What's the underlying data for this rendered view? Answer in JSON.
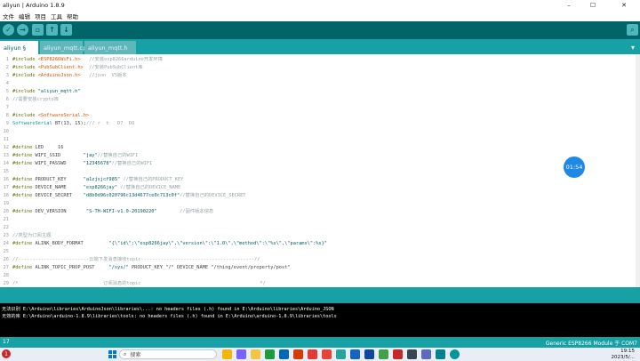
{
  "window": {
    "title": "aliyun | Arduino 1.8.9",
    "min": "–",
    "max": "☐",
    "close": "✕"
  },
  "menu": [
    "文件",
    "编辑",
    "项目",
    "工具",
    "帮助"
  ],
  "toolbar": {
    "verify": "✓",
    "upload": "→",
    "new": "▫",
    "open": "↑",
    "save": "↓",
    "serial_monitor": "⌕"
  },
  "tabs": [
    {
      "label": "aliyun §",
      "active": true
    },
    {
      "label": "aliyun_mqtt.cpp",
      "active": false
    },
    {
      "label": "aliyun_mqtt.h",
      "active": false
    }
  ],
  "tab_menu": "▾",
  "code": [
    {
      "n": "1",
      "segs": [
        [
          "kw",
          "#include "
        ],
        [
          "hl",
          "<ESP8266WiFi.h>"
        ],
        [
          "cm",
          "   //安装esp8266arduino开发环境"
        ]
      ]
    },
    {
      "n": "2",
      "segs": [
        [
          "kw",
          "#include "
        ],
        [
          "hl",
          "<PubSubClient.h>"
        ],
        [
          "cm",
          "  //安装PubSubClient库"
        ]
      ]
    },
    {
      "n": "3",
      "segs": [
        [
          "kw",
          "#include "
        ],
        [
          "hl",
          "<ArduinoJson.h>"
        ],
        [
          "cm",
          "   //json  V5版本"
        ]
      ]
    },
    {
      "n": "4",
      "segs": []
    },
    {
      "n": "5",
      "segs": [
        [
          "kw",
          "#include "
        ],
        [
          "str",
          "\"aliyun_mqtt.h\""
        ]
      ]
    },
    {
      "n": "6",
      "segs": [
        [
          "cm",
          "//需要安装crypto库"
        ]
      ]
    },
    {
      "n": "7",
      "segs": []
    },
    {
      "n": "8",
      "segs": [
        [
          "kw",
          "#include "
        ],
        [
          "hl",
          "<SoftwareSerial.h>"
        ]
      ]
    },
    {
      "n": "9",
      "segs": [
        [
          "ty",
          "SoftwareSerial"
        ],
        [
          "",
          " BT(13, 15);"
        ],
        [
          "cm",
          "/// r  t   D7  D8"
        ]
      ]
    },
    {
      "n": "10",
      "segs": []
    },
    {
      "n": "11",
      "segs": []
    },
    {
      "n": "12",
      "segs": [
        [
          "kw",
          "#define "
        ],
        [
          "",
          "LED     16"
        ]
      ]
    },
    {
      "n": "13",
      "segs": [
        [
          "kw",
          "#define "
        ],
        [
          "",
          "WIFI_SSID        "
        ],
        [
          "str",
          "\"jay\""
        ],
        [
          "cm",
          "//替换自己的WIFI"
        ]
      ]
    },
    {
      "n": "14",
      "segs": [
        [
          "kw",
          "#define "
        ],
        [
          "",
          "WIFI_PASSWD      "
        ],
        [
          "str",
          "\"12345678\""
        ],
        [
          "cm",
          "//替换自己的WIFI"
        ]
      ]
    },
    {
      "n": "15",
      "segs": []
    },
    {
      "n": "16",
      "segs": [
        [
          "kw",
          "#define "
        ],
        [
          "",
          "PRODUCT_KEY      "
        ],
        [
          "str",
          "\"a1zjsjcf985\""
        ],
        [
          "cm",
          " //替换自己的PRODUCT_KEY"
        ]
      ]
    },
    {
      "n": "17",
      "segs": [
        [
          "kw",
          "#define "
        ],
        [
          "",
          "DEVICE_NAME      "
        ],
        [
          "str",
          "\"esp8266jay\""
        ],
        [
          "cm",
          " //替换自己的DEVICE_NAME"
        ]
      ]
    },
    {
      "n": "18",
      "segs": [
        [
          "kw",
          "#define "
        ],
        [
          "",
          "DEVICE_SECRET    "
        ],
        [
          "str",
          "\"d8b0d96c020796c13d4677ce0c713c0f\""
        ],
        [
          "cm",
          "//替换自己的DEVICE_SECRET"
        ]
      ]
    },
    {
      "n": "19",
      "segs": []
    },
    {
      "n": "20",
      "segs": [
        [
          "kw",
          "#define "
        ],
        [
          "",
          "DEV_VERSION       "
        ],
        [
          "str",
          "\"S-TH-WIFI-v1.0-20190220\""
        ],
        [
          "cm",
          "        //固件版本信息"
        ]
      ]
    },
    {
      "n": "21",
      "segs": []
    },
    {
      "n": "22",
      "segs": []
    },
    {
      "n": "23",
      "segs": [
        [
          "cm",
          "//类型为订阅主题"
        ]
      ]
    },
    {
      "n": "24",
      "segs": [
        [
          "kw",
          "#define "
        ],
        [
          "",
          "ALINK_BODY_FORMAT         "
        ],
        [
          "str",
          "\"{\\\"id\\\":\\\"esp8266jay\\\",\\\"version\\\":\\\"1.0\\\",\\\"method\\\":\\\"%s\\\",\\\"params\\\":%s}\""
        ]
      ]
    },
    {
      "n": "25",
      "segs": []
    },
    {
      "n": "26",
      "segs": [
        [
          "cm",
          "//-------------------------云端下发消息接收topic----------------------------------------//"
        ]
      ]
    },
    {
      "n": "27",
      "segs": [
        [
          "kw",
          "#define "
        ],
        [
          "",
          "ALINK_TOPIC_PROP_POST     "
        ],
        [
          "str",
          "\"/sys/\""
        ],
        [
          "",
          " PRODUCT_KEY \"/\" DEVICE_NAME \"/thing/event/property/post\""
        ]
      ]
    },
    {
      "n": "28",
      "segs": []
    },
    {
      "n": "29",
      "segs": [
        [
          "cm",
          "/*                              订阅消息的topic                                          */"
        ]
      ]
    }
  ],
  "clock_bubble": "01:54",
  "console": [
    "无法识别 E:\\Arduino\\libraries\\ArduinoJson\\libraries\\...: no headers files (.h) found in E:\\Arduino\\libraries\\Arduino_JSON",
    "无效的库 E:\\Arduino\\arduino-1.8.9\\libraries\\tools: no headers files (.h) found in E:\\Arduino\\arduino-1.8.9\\libraries\\tools"
  ],
  "status": {
    "line": "17",
    "board": "Generic ESP8266 Module 于 COM7"
  },
  "taskbar": {
    "notification_count": "1",
    "search_placeholder": "搜索",
    "time": "19:15",
    "date": "2023/5/..."
  }
}
